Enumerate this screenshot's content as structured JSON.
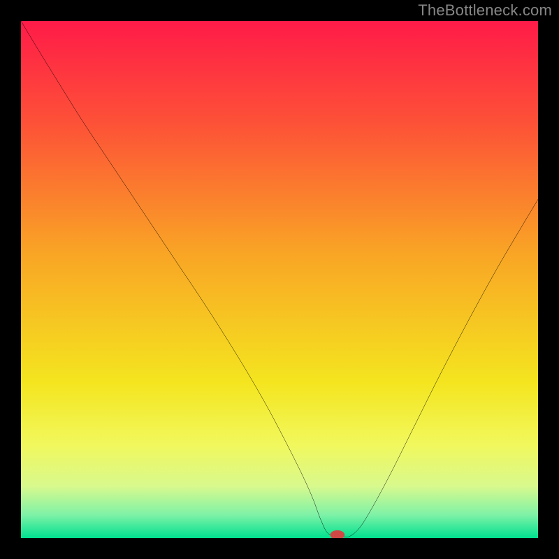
{
  "watermark": "TheBottleneck.com",
  "chart_data": {
    "type": "line",
    "title": "",
    "xlabel": "",
    "ylabel": "",
    "xlim": [
      0,
      100
    ],
    "ylim": [
      0,
      100
    ],
    "grid": false,
    "legend": false,
    "gradient_stops": [
      {
        "offset": 0.0,
        "color": "#ff1b48"
      },
      {
        "offset": 0.2,
        "color": "#fd5237"
      },
      {
        "offset": 0.45,
        "color": "#f9a525"
      },
      {
        "offset": 0.7,
        "color": "#f4e51f"
      },
      {
        "offset": 0.82,
        "color": "#f1f85d"
      },
      {
        "offset": 0.9,
        "color": "#d8f98d"
      },
      {
        "offset": 0.955,
        "color": "#7ff2a7"
      },
      {
        "offset": 1.0,
        "color": "#00e08f"
      }
    ],
    "series": [
      {
        "name": "bottleneck-curve",
        "x": [
          0.0,
          3.0,
          7.0,
          12.0,
          18.0,
          24.0,
          30.0,
          36.0,
          42.0,
          47.0,
          51.0,
          54.5,
          56.5,
          58.0,
          59.5,
          62.0,
          63.5,
          65.5,
          68.0,
          71.5,
          76.0,
          81.0,
          86.5,
          92.0,
          97.0,
          100.0
        ],
        "y": [
          100.0,
          95.0,
          88.5,
          80.5,
          71.5,
          62.5,
          53.5,
          44.5,
          35.0,
          26.5,
          19.0,
          12.0,
          7.5,
          3.5,
          0.8,
          0.3,
          0.3,
          2.0,
          6.0,
          12.5,
          21.5,
          31.5,
          42.0,
          52.0,
          60.5,
          65.5
        ]
      }
    ],
    "marker": {
      "x": 61.2,
      "y": 0.6,
      "color": "#cf4843",
      "rx": 1.4,
      "ry": 0.9
    }
  }
}
